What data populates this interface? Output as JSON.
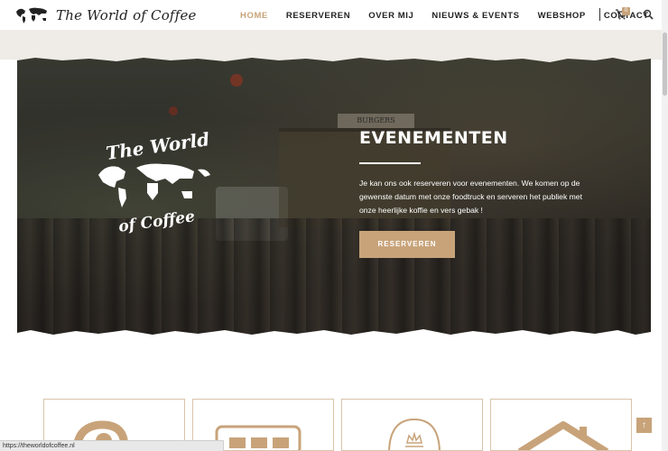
{
  "header": {
    "logo_text": "The World of Coffee",
    "nav": [
      {
        "label": "HOME",
        "active": true
      },
      {
        "label": "RESERVEREN",
        "active": false
      },
      {
        "label": "OVER MIJ",
        "active": false
      },
      {
        "label": "NIEUWS & EVENTS",
        "active": false
      },
      {
        "label": "WEBSHOP",
        "active": false
      },
      {
        "label": "CONTACT",
        "active": false
      }
    ],
    "cart_count": "0",
    "cart_icon": "cart-icon",
    "search_icon": "search-icon"
  },
  "hero": {
    "logo_top": "The World",
    "logo_bottom": "of Coffee",
    "truck_sign": "BURGERS",
    "title": "EVENEMENTEN",
    "text": "Je kan ons ook reserveren voor evenementen. We komen op de gewenste datum met onze foodtruck en serveren het publiek met onze heerlijke koffie en vers gebak !",
    "button_label": "RESERVEREN"
  },
  "status_url": "https://theworldofcoffee.nl",
  "back_to_top": "↑",
  "colors": {
    "accent": "#c8a37a",
    "text": "#222222",
    "band": "#efebe6"
  }
}
